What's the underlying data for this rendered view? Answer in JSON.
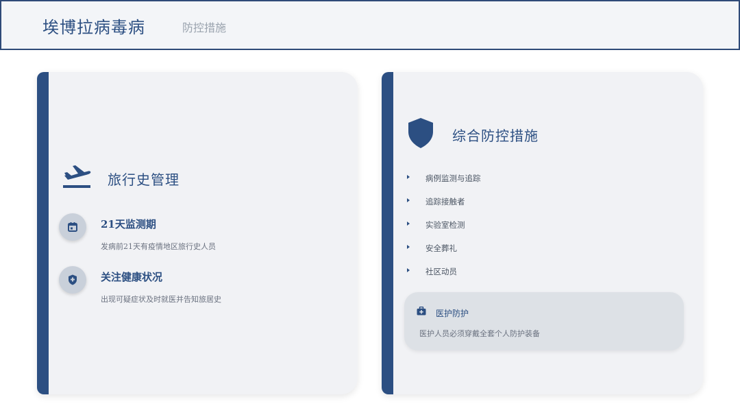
{
  "header": {
    "title": "埃博拉病毒病",
    "subtitle": "防控措施"
  },
  "left_card": {
    "heading": "旅行史管理",
    "heading_icon": "airplane-takeoff-icon",
    "items": [
      {
        "icon": "calendar-icon",
        "title": "21天监测期",
        "desc": "发病前21天有疫情地区旅行史人员"
      },
      {
        "icon": "shield-plus-icon",
        "title": "关注健康状况",
        "desc": "出现可疑症状及时就医并告知旅居史"
      }
    ]
  },
  "right_card": {
    "heading": "综合防控措施",
    "heading_icon": "shield-icon",
    "bullets": [
      "病例监测与追踪",
      "追踪接触者",
      "实验室检测",
      "安全葬礼",
      "社区动员"
    ],
    "note": {
      "icon": "medical-kit-icon",
      "title": "医护防护",
      "desc": "医护人员必须穿戴全套个人防护装备"
    }
  },
  "colors": {
    "accent": "#2c4f82",
    "card_bg": "#f1f2f5",
    "note_bg": "#dde1e6",
    "muted_text": "#6b7280"
  }
}
